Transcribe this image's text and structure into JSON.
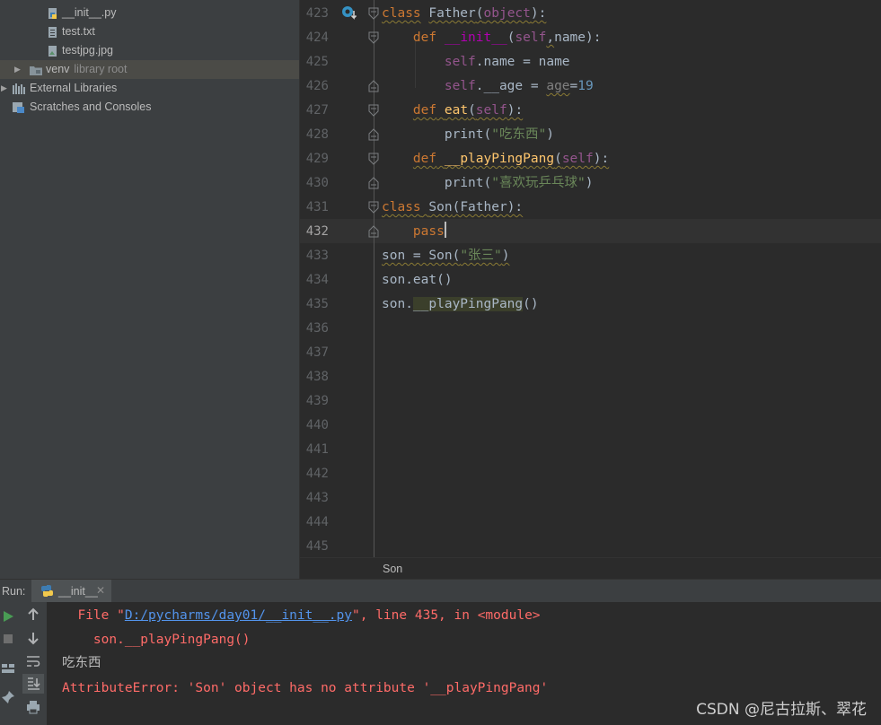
{
  "project_tree": {
    "items": [
      {
        "label": "__init__.py",
        "icon": "python-file-icon"
      },
      {
        "label": "test.txt",
        "icon": "text-file-icon"
      },
      {
        "label": "testjpg.jpg",
        "icon": "image-file-icon"
      },
      {
        "label": "venv",
        "suffix": "library root",
        "icon": "folder-icon"
      },
      {
        "label": "External Libraries",
        "icon": "libraries-icon"
      },
      {
        "label": "Scratches and Consoles",
        "icon": "scratches-icon"
      }
    ]
  },
  "editor": {
    "line_numbers": [
      "423",
      "424",
      "425",
      "426",
      "427",
      "428",
      "429",
      "430",
      "431",
      "432",
      "433",
      "434",
      "435",
      "436",
      "437",
      "438",
      "439",
      "440",
      "441",
      "442",
      "443",
      "444",
      "445"
    ],
    "current_line": "432",
    "code": {
      "l423_kw": "class",
      "l423_name": "Father",
      "l423_open": "(",
      "l423_base": "object",
      "l423_close": "):",
      "l424_kw": "def",
      "l424_fn": "__init__",
      "l424_open": "(",
      "l424_self": "self",
      "l424_comma": ",",
      "l424_rest": "name):",
      "l425_self": "self",
      "l425_rest": ".name = name",
      "l426_self": "self",
      "l426_mid": ".__age = ",
      "l426_param": "age",
      "l426_eq": "=",
      "l426_num": "19",
      "l427_kw": "def",
      "l427_fn": "eat",
      "l427_open": "(",
      "l427_self": "self",
      "l427_close": "):",
      "l428_print": "print",
      "l428_open": "(",
      "l428_str": "\"吃东西\"",
      "l428_close": ")",
      "l429_kw": "def",
      "l429_fn": "__playPingPang",
      "l429_open": "(",
      "l429_self": "self",
      "l429_close": "):",
      "l430_print": "print",
      "l430_open": "(",
      "l430_str": "\"喜欢玩乒乓球\"",
      "l430_close": ")",
      "l431_kw": "class",
      "l431_name": "Son",
      "l431_rest": "(Father):",
      "l432_kw": "pass",
      "l433_a": "son = Son(",
      "l433_str": "\"张三\"",
      "l433_b": ")",
      "l434": "son.eat()",
      "l435_a": "son.",
      "l435_hl": "__playPingPang",
      "l435_b": "()"
    }
  },
  "breadcrumb": {
    "text": "Son"
  },
  "run_panel": {
    "label": "Run:",
    "tab_label": "__init__",
    "console": {
      "l1_a": "  File \"",
      "l1_link": "D:/pycharms/day01/__init__.py",
      "l1_b": "\", line 435, in <module>",
      "l2": "    son.__playPingPang()",
      "l3": "吃东西",
      "l4": "AttributeError: 'Son' object has no attribute '__playPingPang'"
    }
  },
  "watermark": "CSDN @尼古拉斯、翠花",
  "colors": {
    "keyword": "#cc7832",
    "function": "#ffc66d",
    "self": "#94558d",
    "string": "#6a8759",
    "number": "#6897bb",
    "error": "#ff6b68",
    "link": "#5394ec"
  }
}
